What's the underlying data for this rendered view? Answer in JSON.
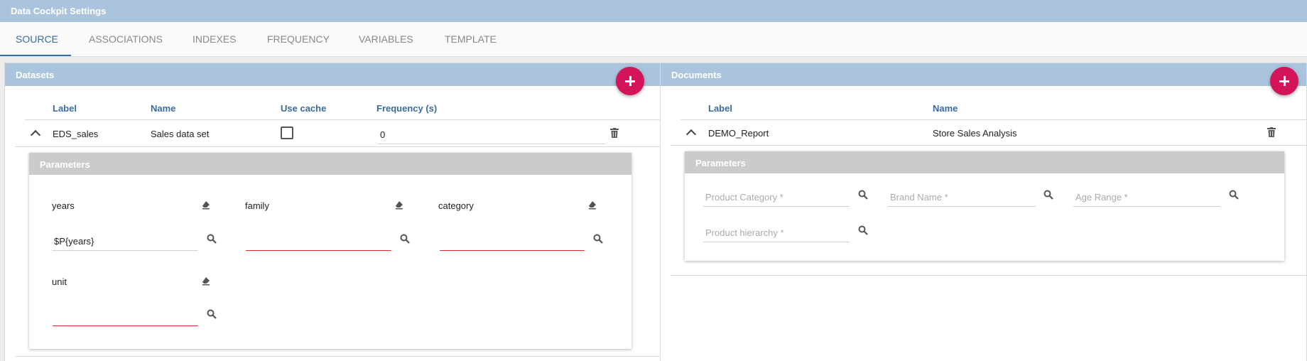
{
  "window": {
    "title": "Data Cockpit Settings"
  },
  "tabs": [
    {
      "label": "SOURCE",
      "active": true
    },
    {
      "label": "ASSOCIATIONS",
      "active": false
    },
    {
      "label": "INDEXES",
      "active": false
    },
    {
      "label": "FREQUENCY",
      "active": false
    },
    {
      "label": "VARIABLES",
      "active": false
    },
    {
      "label": "TEMPLATE",
      "active": false
    }
  ],
  "datasets": {
    "title": "Datasets",
    "columns": {
      "label": "Label",
      "name": "Name",
      "use_cache": "Use cache",
      "frequency": "Frequency (s)"
    },
    "row": {
      "label": "EDS_sales",
      "name": "Sales data set",
      "use_cache": false,
      "frequency": "0"
    },
    "parameters": {
      "title": "Parameters",
      "items": [
        {
          "label": "years",
          "value": "$P{years}"
        },
        {
          "label": "family",
          "value": ""
        },
        {
          "label": "category",
          "value": ""
        },
        {
          "label": "unit",
          "value": ""
        }
      ]
    }
  },
  "documents": {
    "title": "Documents",
    "columns": {
      "label": "Label",
      "name": "Name"
    },
    "row": {
      "label": "DEMO_Report",
      "name": "Store Sales Analysis"
    },
    "parameters": {
      "title": "Parameters",
      "items": [
        {
          "placeholder": "Product Category *"
        },
        {
          "placeholder": "Brand Name *"
        },
        {
          "placeholder": "Age Range *"
        },
        {
          "placeholder": "Product hierarchy *"
        }
      ]
    }
  },
  "colors": {
    "header": "#a9c4dc",
    "accent": "#3b6aa0",
    "fab": "#d4145a",
    "error": "#d32f2f"
  },
  "icons": {
    "add": "plus-icon",
    "expand": "chevron-up-icon",
    "delete": "trash-icon",
    "clear": "eraser-icon",
    "lookup": "search-icon"
  }
}
